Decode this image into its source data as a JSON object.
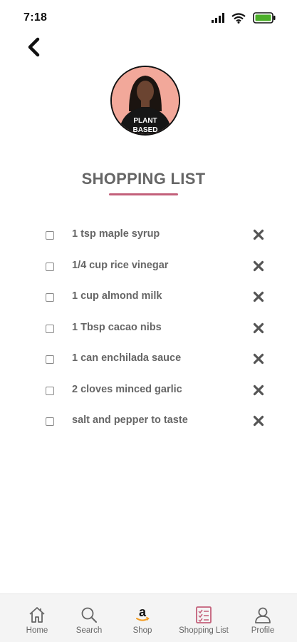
{
  "status_bar": {
    "time": "7:18"
  },
  "header": {
    "title": "SHOPPING LIST"
  },
  "colors": {
    "accent": "#c3607a",
    "battery": "#4caf2a",
    "avatar_bg": "#f2a89a"
  },
  "avatar": {
    "shirt_text_line1": "PLANT",
    "shirt_text_line2": "BASED"
  },
  "shopping_list": {
    "items": [
      {
        "label": "1 tsp maple syrup",
        "checked": false
      },
      {
        "label": "1/4 cup rice vinegar",
        "checked": false
      },
      {
        "label": "1 cup almond milk",
        "checked": false
      },
      {
        "label": "1 Tbsp cacao nibs",
        "checked": false
      },
      {
        "label": "1 can enchilada sauce",
        "checked": false
      },
      {
        "label": "2 cloves minced garlic",
        "checked": false
      },
      {
        "label": "salt and pepper to taste",
        "checked": false
      }
    ]
  },
  "bottom_nav": {
    "items": [
      {
        "label": "Home",
        "icon": "home-icon"
      },
      {
        "label": "Search",
        "icon": "search-icon"
      },
      {
        "label": "Shop",
        "icon": "amazon-icon"
      },
      {
        "label": "Shopping List",
        "icon": "checklist-icon",
        "active": true
      },
      {
        "label": "Profile",
        "icon": "profile-icon"
      }
    ]
  }
}
